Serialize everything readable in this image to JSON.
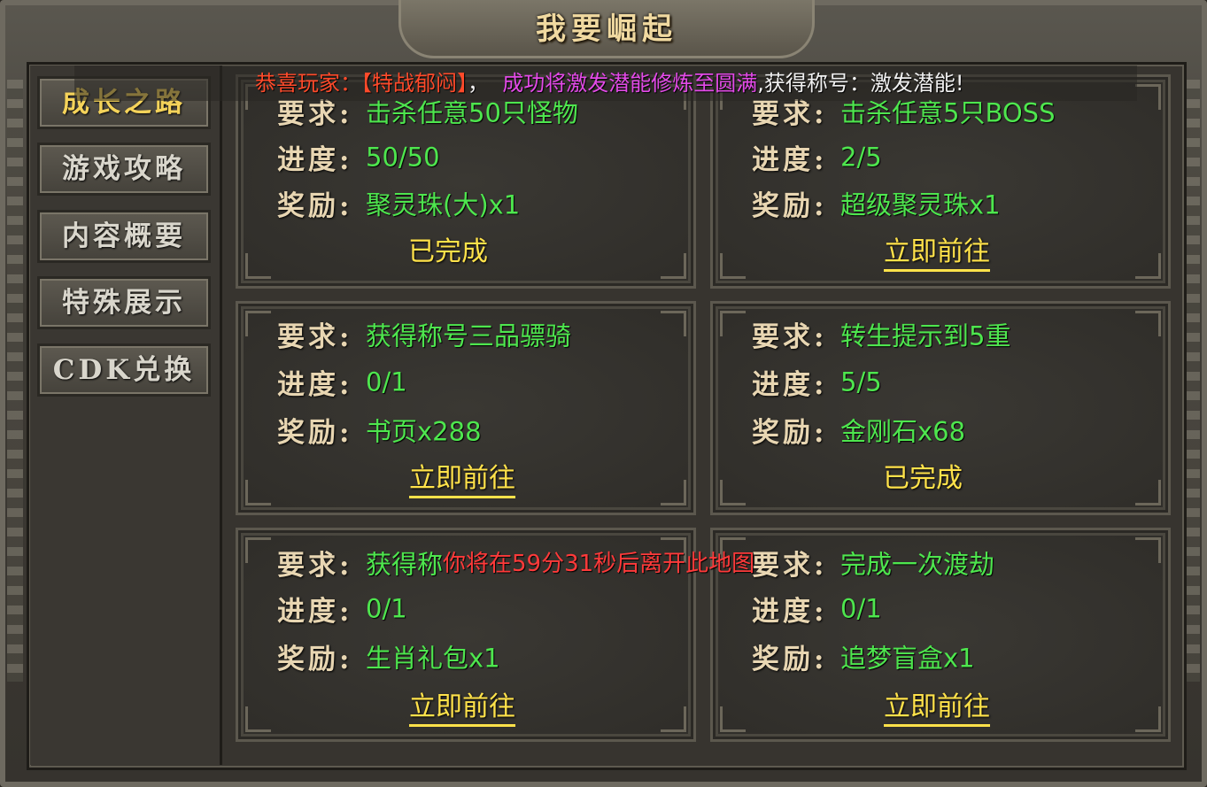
{
  "window": {
    "title": "我要崛起"
  },
  "announcement": {
    "prefix": "恭喜玩家：",
    "player": "【特战郁闷】",
    "separator": "，",
    "action": "成功将激发潜能修炼至圆满",
    "suffix": ",获得称号：激发潜能!",
    "colors": {
      "prefix": "#ff4a2a",
      "player": "#ff4a2a",
      "action": "#e34ae8",
      "suffix": "#f0f0f0"
    }
  },
  "sidebar": {
    "items": [
      {
        "label": "成长之路",
        "active": true
      },
      {
        "label": "游戏攻略",
        "active": false
      },
      {
        "label": "内容概要",
        "active": false
      },
      {
        "label": "特殊展示",
        "active": false
      },
      {
        "label": "CDK兑换",
        "active": false
      }
    ]
  },
  "labels": {
    "requirement": "要求:",
    "progress": "进度:",
    "reward": "奖励:"
  },
  "tasks": [
    {
      "requirement": "击杀任意50只怪物",
      "progress": "50/50",
      "reward": "聚灵珠(大)x1",
      "action": "已完成",
      "completed": true
    },
    {
      "requirement": "击杀任意5只BOSS",
      "progress": "2/5",
      "reward": "超级聚灵珠x1",
      "action": "立即前往",
      "completed": false
    },
    {
      "requirement": "获得称号三品骠骑",
      "progress": "0/1",
      "reward": "书页x288",
      "action": "立即前往",
      "completed": false
    },
    {
      "requirement": "转生提示到5重",
      "progress": "5/5",
      "reward": "金刚石x68",
      "action": "已完成",
      "completed": true
    },
    {
      "requirement": "获得称",
      "progress": "0/1",
      "reward": "生肖礼包x1",
      "action": "立即前往",
      "completed": false
    },
    {
      "requirement": "完成一次渡劫",
      "progress": "0/1",
      "reward": "追梦盲盒x1",
      "action": "立即前往",
      "completed": false
    }
  ],
  "system_message": "你将在59分31秒后离开此地图",
  "colors": {
    "value_green": "#4ee64e",
    "action_yellow": "#ffe24a",
    "active_nav": "#f5d35a",
    "warning_red": "#ff3a3a"
  }
}
